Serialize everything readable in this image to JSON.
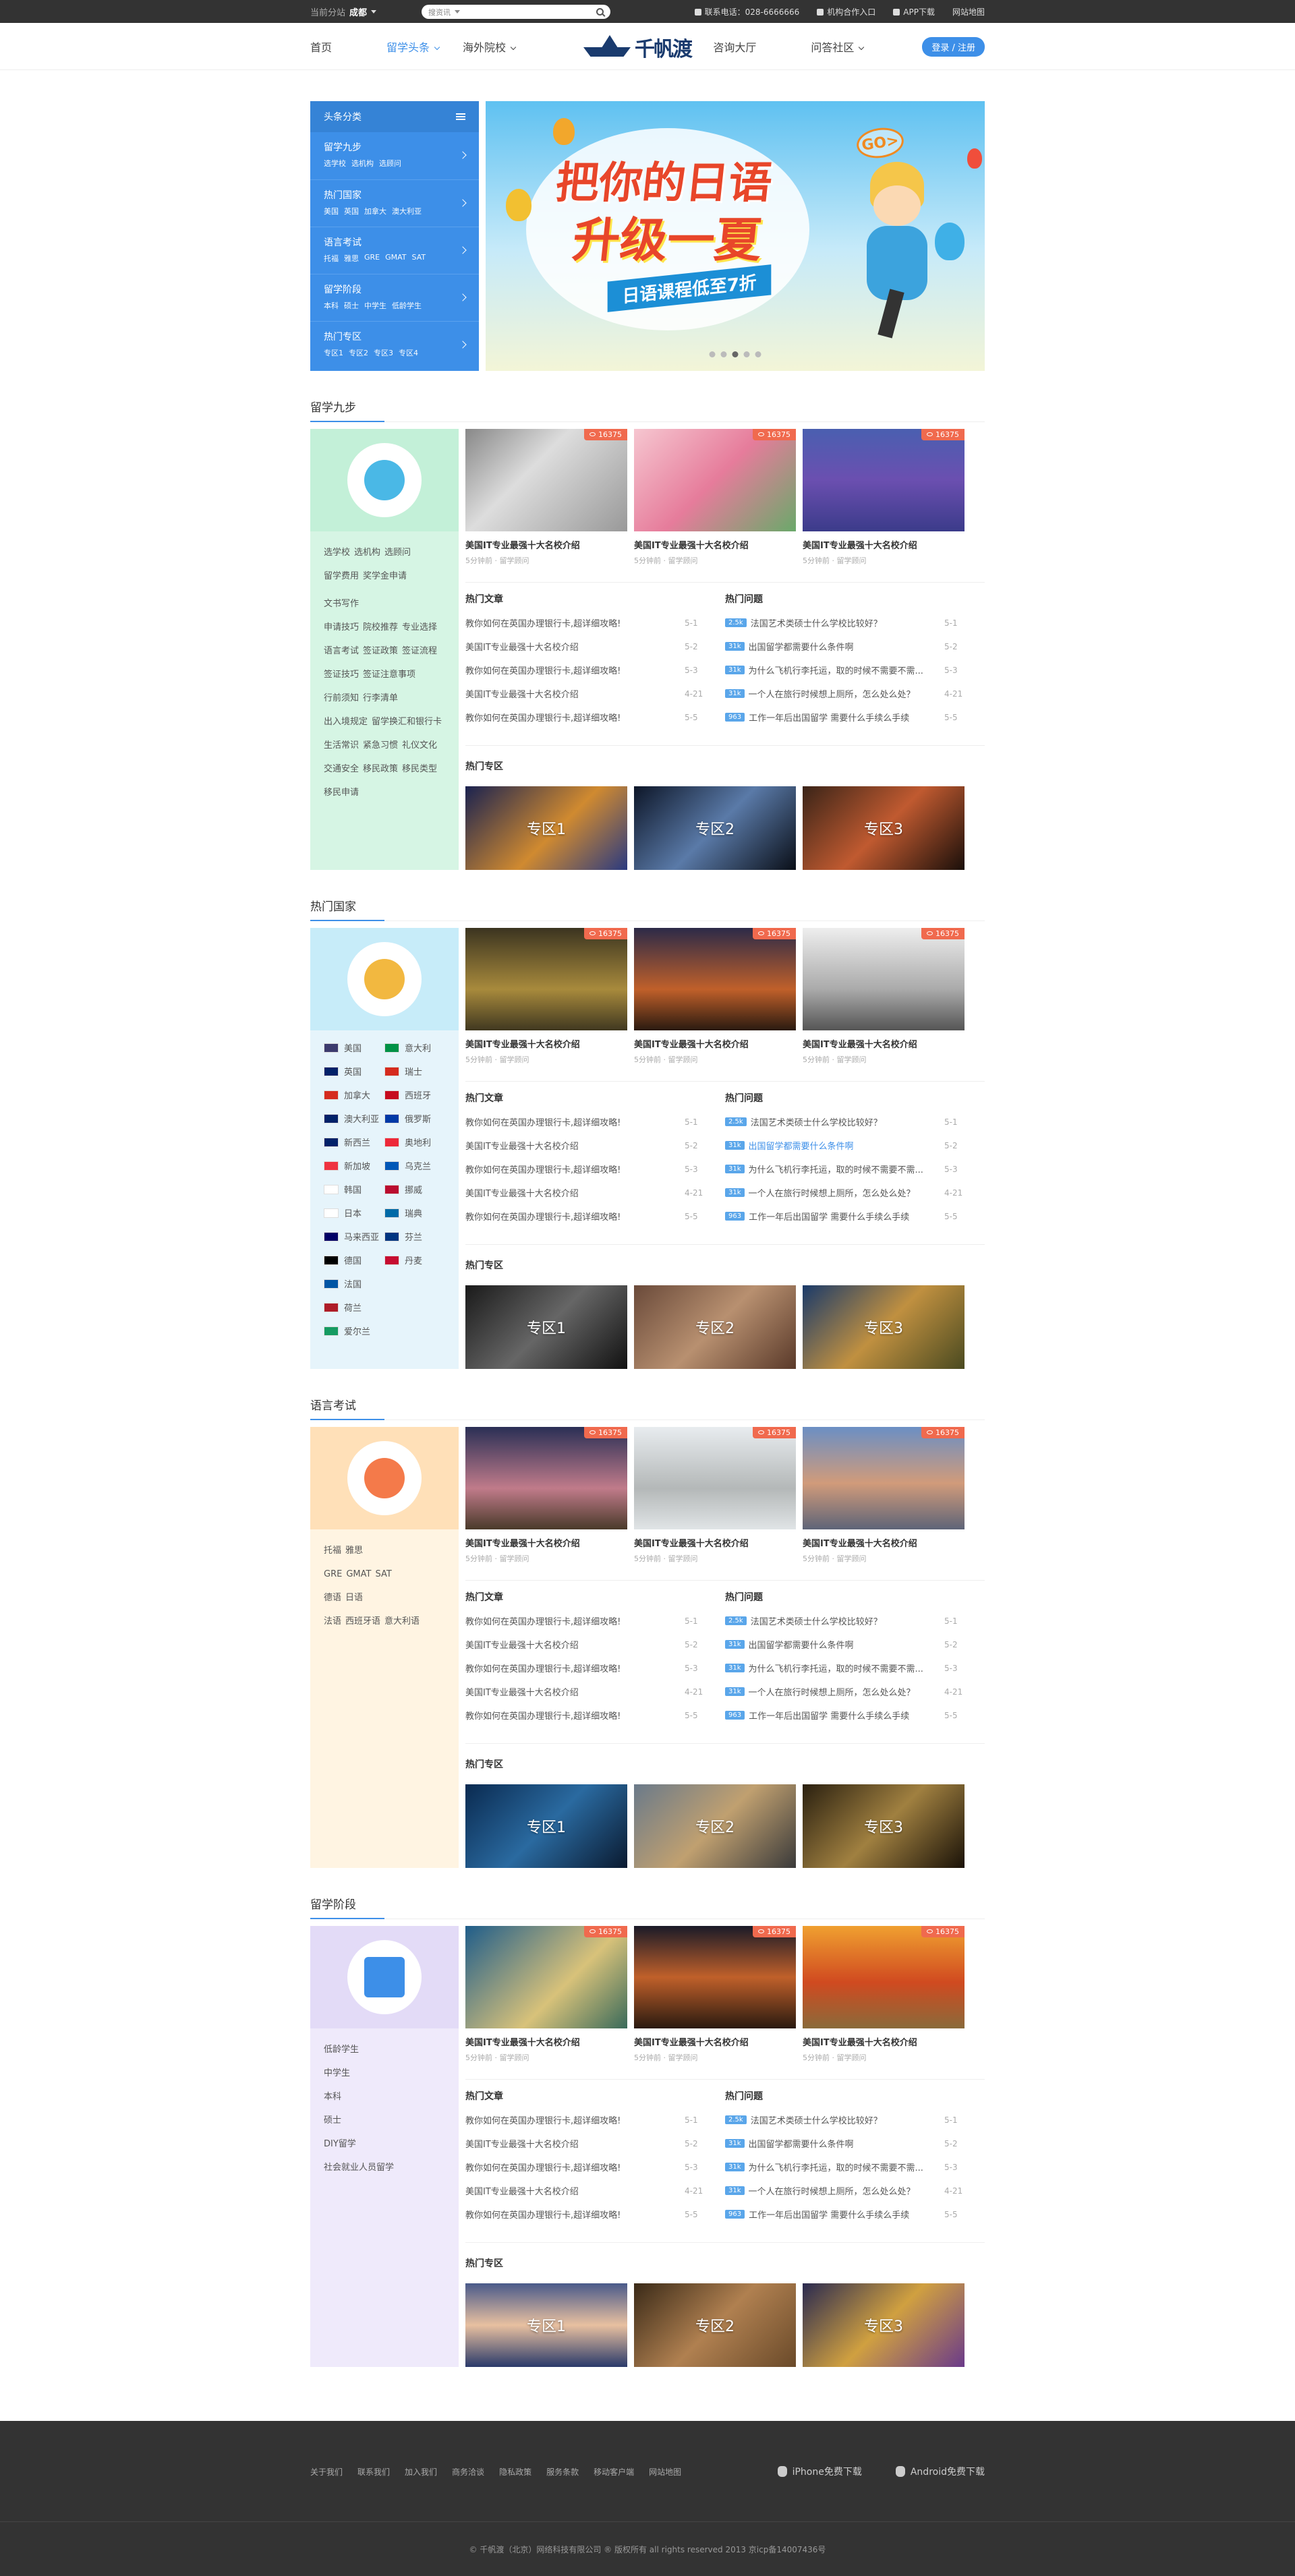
{
  "topbar": {
    "city_label": "当前分站",
    "city": "成都",
    "search_placeholder": "搜资讯",
    "phone": "联系电话：028-6666666",
    "partner": "机构合作入口",
    "app": "APP下载",
    "sitemap": "网站地图"
  },
  "nav": {
    "items_left": [
      "首页",
      "留学头条",
      "海外院校"
    ],
    "items_right": [
      "咨询大厅",
      "问答社区"
    ],
    "logo_text": "千帆渡",
    "login": "登录 / 注册"
  },
  "categories": {
    "head": "头条分类",
    "items": [
      {
        "title": "留学九步",
        "subs": [
          "选学校",
          "选机构",
          "选顾问"
        ]
      },
      {
        "title": "热门国家",
        "subs": [
          "美国",
          "英国",
          "加拿大",
          "澳大利亚"
        ]
      },
      {
        "title": "语言考试",
        "subs": [
          "托福",
          "雅思",
          "GRE",
          "GMAT",
          "SAT"
        ]
      },
      {
        "title": "留学阶段",
        "subs": [
          "本科",
          "硕士",
          "中学生",
          "低龄学生"
        ]
      },
      {
        "title": "热门专区",
        "subs": [
          "专区1",
          "专区2",
          "专区3",
          "专区4"
        ]
      }
    ]
  },
  "banner": {
    "line1": "把你的日语",
    "line2": "升级一夏",
    "line3": "日语课程低至7折",
    "go": "GO>"
  },
  "common": {
    "card_title": "美国IT专业最强十大名校介绍",
    "card_meta": "5分钟前 · 留学顾问",
    "views": "16375",
    "articles_title": "热门文章",
    "questions_title": "热门问题",
    "zones_title": "热门专区",
    "articles": [
      {
        "t": "教你如何在英国办理银行卡,超详细攻略!",
        "d": "5-1"
      },
      {
        "t": "美国IT专业最强十大名校介绍",
        "d": "5-2"
      },
      {
        "t": "教你如何在英国办理银行卡,超详细攻略!",
        "d": "5-3"
      },
      {
        "t": "美国IT专业最强十大名校介绍",
        "d": "4-21"
      },
      {
        "t": "教你如何在英国办理银行卡,超详细攻略!",
        "d": "5-5"
      }
    ],
    "questions": [
      {
        "b": "2.5k",
        "t": "法国艺术类硕士什么学校比较好？",
        "d": "5-1"
      },
      {
        "b": "31k",
        "t": "出国留学都需要什么条件啊",
        "d": "5-2"
      },
      {
        "b": "31k",
        "t": "为什么飞机行李托运，取的时候不需要不需...",
        "d": "5-3"
      },
      {
        "b": "31k",
        "t": "一个人在旅行时候想上厕所，怎么处么处？",
        "d": "4-21"
      },
      {
        "b": "963",
        "t": "工作一年后出国留学 需要什么手续么手续",
        "d": "5-5"
      }
    ],
    "zones": [
      "专区1",
      "专区2",
      "专区3"
    ]
  },
  "sections": [
    {
      "title": "留学九步",
      "links": [
        [
          "选学校",
          "选机构",
          "选顾问"
        ],
        [
          "留学费用",
          "奖学金申请",
          "文书写作"
        ],
        [
          "申请技巧",
          "院校推荐",
          "专业选择"
        ],
        [
          "语言考试",
          "签证政策",
          "签证流程"
        ],
        [
          "签证技巧",
          "签证注意事项"
        ],
        [
          "行前须知",
          "行李清单"
        ],
        [
          "出入境规定",
          "留学换汇和银行卡"
        ],
        [
          "生活常识",
          "紧急习惯",
          "礼仪文化"
        ],
        [
          "交通安全",
          "移民政策",
          "移民类型"
        ],
        [
          "移民申请"
        ]
      ]
    },
    {
      "title": "热门国家",
      "flags": [
        "美国",
        "意大利",
        "英国",
        "瑞士",
        "加拿大",
        "西班牙",
        "澳大利亚",
        "俄罗斯",
        "新西兰",
        "奥地利",
        "新加坡",
        "乌克兰",
        "韩国",
        "挪威",
        "日本",
        "瑞典",
        "马来西亚",
        "芬兰",
        "德国",
        "丹麦",
        "法国",
        "",
        "荷兰",
        "",
        "爱尔兰",
        ""
      ]
    },
    {
      "title": "语言考试",
      "links": [
        [
          "托福",
          "雅思"
        ],
        [
          "GRE",
          "GMAT",
          "SAT"
        ],
        [
          "德语",
          "日语"
        ],
        [
          "法语",
          "西班牙语",
          "意大利语"
        ]
      ]
    },
    {
      "title": "留学阶段",
      "links": [
        [
          "低龄学生"
        ],
        [
          "中学生"
        ],
        [
          "本科"
        ],
        [
          "硕士"
        ],
        [
          "DIY留学"
        ],
        [
          "社会就业人员留学"
        ]
      ]
    }
  ],
  "footer": {
    "links": [
      "关于我们",
      "联系我们",
      "加入我们",
      "商务洽谈",
      "隐私政策",
      "服务条款",
      "移动客户端",
      "网站地图"
    ],
    "iphone": "iPhone免费下载",
    "android": "Android免费下载",
    "copyright": "© 千帆渡（北京）网络科技有限公司 ® 版权所有 all rights reserved 2013 京icp备14007436号"
  },
  "colors": {
    "accent": "#3d8fe8",
    "badge": "#f06a4e"
  }
}
